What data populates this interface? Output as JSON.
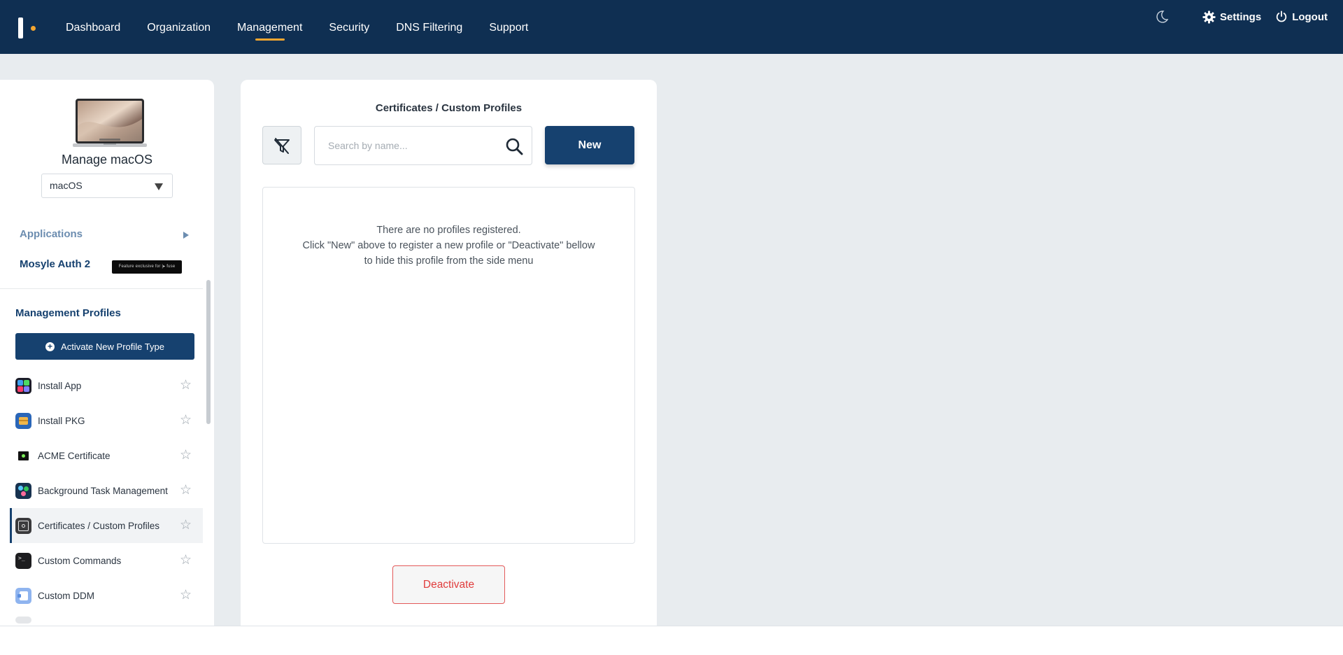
{
  "nav": {
    "items": [
      {
        "label": "Dashboard",
        "active": false
      },
      {
        "label": "Organization",
        "active": false
      },
      {
        "label": "Management",
        "active": true
      },
      {
        "label": "Security",
        "active": false
      },
      {
        "label": "DNS Filtering",
        "active": false
      },
      {
        "label": "Support",
        "active": false
      }
    ],
    "settings_label": "Settings",
    "logout_label": "Logout",
    "accent_color": "#f4a630",
    "bg_color": "#0f2f52"
  },
  "sidebar": {
    "title": "Manage macOS",
    "os_select_value": "macOS",
    "applications_label": "Applications",
    "mosyle_auth_label": "Mosyle Auth 2",
    "fuse_badge": "Feature exclusive for  |▸ fuse",
    "management_profiles_title": "Management Profiles",
    "activate_button": "Activate New Profile Type",
    "profiles": [
      {
        "label": "Install App",
        "icon": "install-app-icon"
      },
      {
        "label": "Install PKG",
        "icon": "install-pkg-icon"
      },
      {
        "label": "ACME Certificate",
        "icon": "acme-certificate-icon"
      },
      {
        "label": "Background Task Management",
        "icon": "background-task-icon"
      },
      {
        "label": "Certificates / Custom Profiles",
        "icon": "certificates-icon",
        "selected": true
      },
      {
        "label": "Custom Commands",
        "icon": "terminal-icon"
      },
      {
        "label": "Custom DDM",
        "icon": "custom-ddm-icon"
      }
    ]
  },
  "main": {
    "title": "Certificates / Custom Profiles",
    "search_placeholder": "Search by name...",
    "new_button": "New",
    "empty_line1": "There are no profiles registered.",
    "empty_line2": "Click \"New\" above to register a new profile or \"Deactivate\" bellow",
    "empty_line3": "to hide this profile from the side menu",
    "deactivate_button": "Deactivate",
    "primary_color": "#16416f",
    "danger_color": "#e03c3c"
  }
}
